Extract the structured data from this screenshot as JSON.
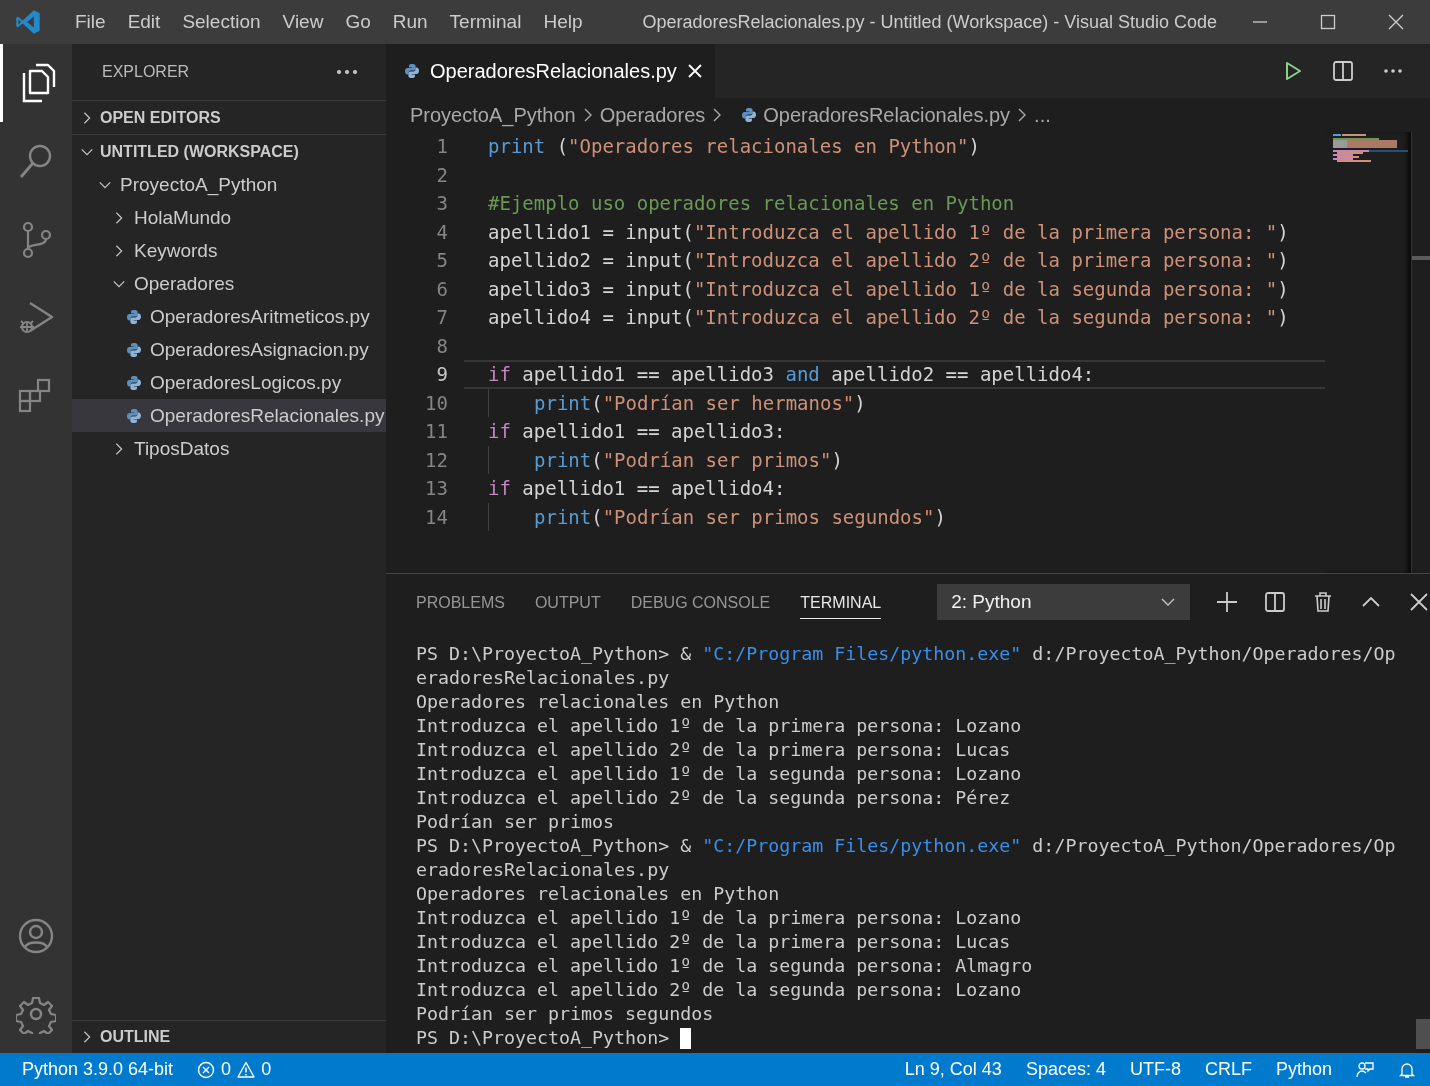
{
  "window": {
    "title": "OperadoresRelacionales.py - Untitled (Workspace) - Visual Studio Code"
  },
  "menu": [
    "File",
    "Edit",
    "Selection",
    "View",
    "Go",
    "Run",
    "Terminal",
    "Help"
  ],
  "activity_bar": [
    {
      "kind": "files",
      "selected": true
    },
    {
      "kind": "search",
      "selected": false
    },
    {
      "kind": "source-control",
      "selected": false
    },
    {
      "kind": "run",
      "selected": false
    },
    {
      "kind": "extensions",
      "selected": false
    }
  ],
  "explorer": {
    "title": "EXPLORER",
    "sections": [
      {
        "label": "OPEN EDITORS",
        "expanded": false
      },
      {
        "label": "UNTITLED (WORKSPACE)",
        "expanded": true,
        "children": [
          {
            "label": "ProyectoA_Python",
            "kind": "folder",
            "expanded": true,
            "selected": false,
            "children": [
              {
                "label": "HolaMundo",
                "kind": "folder",
                "expanded": false,
                "selected": false
              },
              {
                "label": "Keywords",
                "kind": "folder",
                "expanded": false,
                "selected": false
              },
              {
                "label": "Operadores",
                "kind": "folder",
                "expanded": true,
                "selected": false,
                "children": [
                  {
                    "label": "OperadoresAritmeticos.py",
                    "kind": "file",
                    "selected": false
                  },
                  {
                    "label": "OperadoresAsignacion.py",
                    "kind": "file",
                    "selected": false
                  },
                  {
                    "label": "OperadoresLogicos.py",
                    "kind": "file",
                    "selected": false
                  },
                  {
                    "label": "OperadoresRelacionales.py",
                    "kind": "file",
                    "selected": true
                  }
                ]
              },
              {
                "label": "TiposDatos",
                "kind": "folder",
                "expanded": false,
                "selected": false
              }
            ]
          }
        ]
      }
    ],
    "outline": {
      "label": "OUTLINE",
      "expanded": false
    }
  },
  "tabs": [
    {
      "label": "OperadoresRelacionales.py",
      "selected": true
    }
  ],
  "breadcrumbs": [
    {
      "label": "ProyectoA_Python",
      "kind": "folder"
    },
    {
      "label": "Operadores",
      "kind": "folder"
    },
    {
      "label": "OperadoresRelacionales.py",
      "kind": "file"
    },
    {
      "label": "...",
      "kind": "more"
    }
  ],
  "code": [
    {
      "number": "1",
      "current": false,
      "tokens": [
        {
          "kind": "function",
          "text": "print"
        },
        {
          "kind": "plain",
          "text": " ("
        },
        {
          "kind": "string",
          "text": "\"Operadores relacionales en Python\""
        },
        {
          "kind": "plain",
          "text": ")"
        }
      ]
    },
    {
      "number": "2",
      "current": false
    },
    {
      "number": "3",
      "current": false,
      "tokens": [
        {
          "kind": "comment",
          "text": "#Ejemplo uso operadores relacionales en Python"
        }
      ]
    },
    {
      "number": "4",
      "current": false,
      "tokens": [
        {
          "kind": "plain",
          "text": "apellido1 = input("
        },
        {
          "kind": "string",
          "text": "\"Introduzca el apellido 1º de la primera persona: \""
        },
        {
          "kind": "plain",
          "text": ")"
        }
      ]
    },
    {
      "number": "5",
      "current": false,
      "tokens": [
        {
          "kind": "plain",
          "text": "apellido2 = input("
        },
        {
          "kind": "string",
          "text": "\"Introduzca el apellido 2º de la primera persona: \""
        },
        {
          "kind": "plain",
          "text": ")"
        }
      ]
    },
    {
      "number": "6",
      "current": false,
      "tokens": [
        {
          "kind": "plain",
          "text": "apellido3 = input("
        },
        {
          "kind": "string",
          "text": "\"Introduzca el apellido 1º de la segunda persona: \""
        },
        {
          "kind": "plain",
          "text": ")"
        }
      ]
    },
    {
      "number": "7",
      "current": false,
      "tokens": [
        {
          "kind": "plain",
          "text": "apellido4 = input("
        },
        {
          "kind": "string",
          "text": "\"Introduzca el apellido 2º de la segunda persona: \""
        },
        {
          "kind": "plain",
          "text": ")"
        }
      ]
    },
    {
      "number": "8",
      "current": false
    },
    {
      "number": "9",
      "current": true,
      "tokens": [
        {
          "kind": "keyword",
          "text": "if"
        },
        {
          "kind": "plain",
          "text": " apellido1 == apellido3 "
        },
        {
          "kind": "operator",
          "text": "and"
        },
        {
          "kind": "plain",
          "text": " apellido2 == apellido4:"
        }
      ]
    },
    {
      "number": "10",
      "current": false,
      "indented": true,
      "tokens": [
        {
          "kind": "function",
          "text": "print"
        },
        {
          "kind": "plain",
          "text": "("
        },
        {
          "kind": "string",
          "text": "\"Podrían ser hermanos\""
        },
        {
          "kind": "plain",
          "text": ")"
        }
      ]
    },
    {
      "number": "11",
      "current": false,
      "tokens": [
        {
          "kind": "keyword",
          "text": "if"
        },
        {
          "kind": "plain",
          "text": " apellido1 == apellido3:"
        }
      ]
    },
    {
      "number": "12",
      "current": false,
      "indented": true,
      "tokens": [
        {
          "kind": "function",
          "text": "print"
        },
        {
          "kind": "plain",
          "text": "("
        },
        {
          "kind": "string",
          "text": "\"Podrían ser primos\""
        },
        {
          "kind": "plain",
          "text": ")"
        }
      ]
    },
    {
      "number": "13",
      "current": false,
      "tokens": [
        {
          "kind": "keyword",
          "text": "if"
        },
        {
          "kind": "plain",
          "text": " apellido1 == apellido4:"
        }
      ]
    },
    {
      "number": "14",
      "current": false,
      "indented": true,
      "tokens": [
        {
          "kind": "function",
          "text": "print"
        },
        {
          "kind": "plain",
          "text": "("
        },
        {
          "kind": "string",
          "text": "\"Podrían ser primos segundos\""
        },
        {
          "kind": "plain",
          "text": ")"
        }
      ]
    }
  ],
  "panel": {
    "tabs": [
      {
        "label": "PROBLEMS",
        "selected": false
      },
      {
        "label": "OUTPUT",
        "selected": false
      },
      {
        "label": "DEBUG CONSOLE",
        "selected": false
      },
      {
        "label": "TERMINAL",
        "selected": true
      }
    ],
    "terminal_select": {
      "value": "2: Python"
    },
    "cursor": true,
    "terminal": [
      [
        {
          "kind": "plain",
          "text": "PS D:\\ProyectoA_Python> & "
        },
        {
          "kind": "string",
          "text": "\"C:/Program Files/python.exe\""
        },
        {
          "kind": "plain",
          "text": " d:/ProyectoA_Python/Operadores/Op"
        }
      ],
      [
        {
          "kind": "plain",
          "text": "eradoresRelacionales.py"
        }
      ],
      [
        {
          "kind": "plain",
          "text": "Operadores relacionales en Python"
        }
      ],
      [
        {
          "kind": "plain",
          "text": "Introduzca el apellido 1º de la primera persona: Lozano"
        }
      ],
      [
        {
          "kind": "plain",
          "text": "Introduzca el apellido 2º de la primera persona: Lucas"
        }
      ],
      [
        {
          "kind": "plain",
          "text": "Introduzca el apellido 1º de la segunda persona: Lozano"
        }
      ],
      [
        {
          "kind": "plain",
          "text": "Introduzca el apellido 2º de la segunda persona: Pérez"
        }
      ],
      [
        {
          "kind": "plain",
          "text": "Podrían ser primos"
        }
      ],
      [
        {
          "kind": "plain",
          "text": "PS D:\\ProyectoA_Python> & "
        },
        {
          "kind": "string",
          "text": "\"C:/Program Files/python.exe\""
        },
        {
          "kind": "plain",
          "text": " d:/ProyectoA_Python/Operadores/Op"
        }
      ],
      [
        {
          "kind": "plain",
          "text": "eradoresRelacionales.py"
        }
      ],
      [
        {
          "kind": "plain",
          "text": "Operadores relacionales en Python"
        }
      ],
      [
        {
          "kind": "plain",
          "text": "Introduzca el apellido 1º de la primera persona: Lozano"
        }
      ],
      [
        {
          "kind": "plain",
          "text": "Introduzca el apellido 2º de la primera persona: Lucas"
        }
      ],
      [
        {
          "kind": "plain",
          "text": "Introduzca el apellido 1º de la segunda persona: Almagro"
        }
      ],
      [
        {
          "kind": "plain",
          "text": "Introduzca el apellido 2º de la segunda persona: Lozano"
        }
      ],
      [
        {
          "kind": "plain",
          "text": "Podrían ser primos segundos"
        }
      ],
      [
        {
          "kind": "plain",
          "text": "PS D:\\ProyectoA_Python> "
        }
      ]
    ]
  },
  "status_bar": {
    "interpreter": "Python 3.9.0 64-bit",
    "errors": "0",
    "warnings": "0",
    "right": [
      "Ln 9, Col 43",
      "Spaces: 4",
      "UTF-8",
      "CRLF",
      "Python"
    ]
  }
}
